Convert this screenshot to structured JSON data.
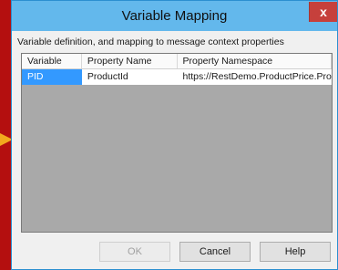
{
  "window": {
    "title": "Variable Mapping",
    "close_label": "x"
  },
  "description": "Variable definition, and mapping to message context properties",
  "columns": [
    "Variable",
    "Property Name",
    "Property Namespace"
  ],
  "rows": [
    {
      "variable": "PID",
      "property_name": "ProductId",
      "property_namespace": "https://RestDemo.ProductPrice.Pro..."
    }
  ],
  "buttons": {
    "ok": "OK",
    "cancel": "Cancel",
    "help": "Help"
  },
  "colors": {
    "desktop": "#b40f0f",
    "titlebar": "#63b8ec",
    "selection": "#3399ff",
    "close": "#c6403c"
  }
}
